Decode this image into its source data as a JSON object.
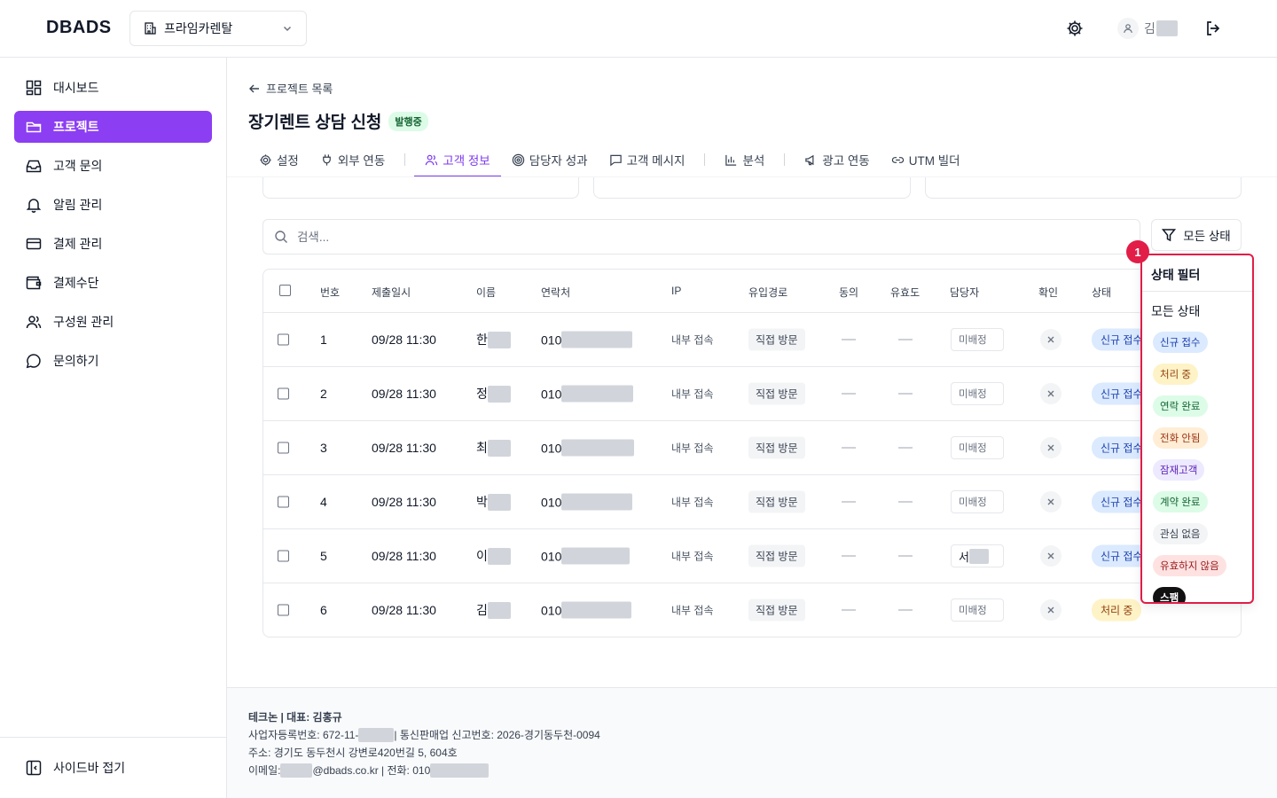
{
  "header": {
    "logo": "DBADS",
    "project": "프라임카렌탈",
    "user_initial": "김"
  },
  "sidebar": {
    "items": [
      {
        "label": "대시보드",
        "icon": "dashboard-icon"
      },
      {
        "label": "프로젝트",
        "icon": "folder-icon"
      },
      {
        "label": "고객 문의",
        "icon": "inbox-icon"
      },
      {
        "label": "알림 관리",
        "icon": "bell-icon"
      },
      {
        "label": "결제 관리",
        "icon": "credit-card-icon"
      },
      {
        "label": "결제수단",
        "icon": "wallet-icon"
      },
      {
        "label": "구성원 관리",
        "icon": "users-icon"
      },
      {
        "label": "문의하기",
        "icon": "chat-icon"
      }
    ],
    "collapse_label": "사이드바 접기"
  },
  "page": {
    "back_label": "프로젝트 목록",
    "title": "장기렌트 상담 신청",
    "badge": "발행중"
  },
  "tabs": [
    {
      "label": "설정",
      "icon": "gear-icon"
    },
    {
      "label": "외부 연동",
      "icon": "plug-icon"
    },
    {
      "label": "고객 정보",
      "icon": "users-icon"
    },
    {
      "label": "담당자 성과",
      "icon": "target-icon"
    },
    {
      "label": "고객 메시지",
      "icon": "message-icon"
    },
    {
      "label": "분석",
      "icon": "bar-chart-icon"
    },
    {
      "label": "광고 연동",
      "icon": "megaphone-icon"
    },
    {
      "label": "UTM 빌더",
      "icon": "link-icon"
    }
  ],
  "search": {
    "placeholder": "검색..."
  },
  "filter_button": "모든 상태",
  "table": {
    "headers": [
      "번호",
      "제출일시",
      "이름",
      "연락처",
      "IP",
      "유입경로",
      "동의",
      "유효도",
      "담당자",
      "확인",
      "상태"
    ],
    "rows": [
      {
        "no": "1",
        "date": "09/28 11:30",
        "name": "한",
        "phone": "010",
        "ip": "내부 접속",
        "source": "직접 방문",
        "assignee": "미배정",
        "status": "신규 접수"
      },
      {
        "no": "2",
        "date": "09/28 11:30",
        "name": "정",
        "phone": "010",
        "ip": "내부 접속",
        "source": "직접 방문",
        "assignee": "미배정",
        "status": "신규 접수"
      },
      {
        "no": "3",
        "date": "09/28 11:30",
        "name": "최",
        "phone": "010",
        "ip": "내부 접속",
        "source": "직접 방문",
        "assignee": "미배정",
        "status": "신규 접수"
      },
      {
        "no": "4",
        "date": "09/28 11:30",
        "name": "박",
        "phone": "010",
        "ip": "내부 접속",
        "source": "직접 방문",
        "assignee": "미배정",
        "status": "신규 접수"
      },
      {
        "no": "5",
        "date": "09/28 11:30",
        "name": "이",
        "phone": "010",
        "ip": "내부 접속",
        "source": "직접 방문",
        "assignee": "서",
        "status": "신규 접수"
      },
      {
        "no": "6",
        "date": "09/28 11:30",
        "name": "김",
        "phone": "010",
        "ip": "내부 접속",
        "source": "직접 방문",
        "assignee": "미배정",
        "status": "처리 중"
      }
    ]
  },
  "status_filter": {
    "marker": "1",
    "title": "상태 필터",
    "all_label": "모든 상태",
    "options": [
      {
        "label": "신규 접수",
        "bg": "#dbeafe",
        "color": "#1e40af"
      },
      {
        "label": "처리 중",
        "bg": "#fef3c7",
        "color": "#92400e"
      },
      {
        "label": "연락 완료",
        "bg": "#dcfce7",
        "color": "#166534"
      },
      {
        "label": "전화 안됨",
        "bg": "#ffedd5",
        "color": "#9a3412"
      },
      {
        "label": "잠재고객",
        "bg": "#ede9fe",
        "color": "#5b21b6"
      },
      {
        "label": "계약 완료",
        "bg": "#dcfce7",
        "color": "#166534"
      },
      {
        "label": "관심 없음",
        "bg": "#f3f4f6",
        "color": "#374151"
      },
      {
        "label": "유효하지 않음",
        "bg": "#fee2e2",
        "color": "#991b1b"
      },
      {
        "label": "스팸",
        "bg": "#111111",
        "color": "#ffffff"
      }
    ]
  },
  "footer": {
    "company": "테크논 | 대표: 김홍규",
    "biz_prefix": "사업자등록번호: 672-11-",
    "biz_suffix": " | 통신판매업 신고번호: 2026-경기동두천-0094",
    "address": "주소: 경기도 동두천시 강변로420번길 5, 604호",
    "email_prefix": "이메일: ",
    "email_suffix": "@dbads.co.kr | 전화: 010"
  },
  "colors": {
    "accent": "#8b3ef2",
    "tab_active": "#7c3aed",
    "highlight": "#e11d48"
  }
}
